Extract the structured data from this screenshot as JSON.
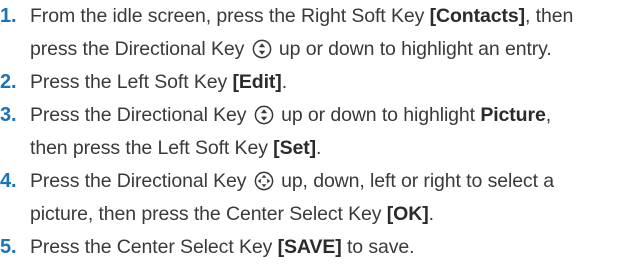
{
  "steps": [
    {
      "number": "1.",
      "line1": {
        "t1": "From the idle screen, press the Right Soft Key ",
        "b1": "[Contacts]",
        "t2": ", then"
      },
      "line2": {
        "t1": "press the Directional Key ",
        "icon": "up-down-navigation-key-icon",
        "t2": " up or down to highlight an entry."
      }
    },
    {
      "number": "2.",
      "line1": {
        "t1": "Press the Left Soft Key ",
        "b1": "[Edit]",
        "t2": "."
      }
    },
    {
      "number": "3.",
      "line1": {
        "t1": "Press the Directional Key ",
        "icon": "up-down-navigation-key-icon",
        "t2": " up or down to highlight ",
        "b1": "Picture",
        "t3": ","
      },
      "line2": {
        "t1": "then press the Left Soft Key ",
        "b1": "[Set]",
        "t2": "."
      }
    },
    {
      "number": "4.",
      "line1": {
        "t1": "Press the Directional Key ",
        "icon": "four-way-navigation-key-icon",
        "t2": " up, down, left or right to select a"
      },
      "line2": {
        "t1": "picture, then press the Center Select Key ",
        "b1": "[OK]",
        "t2": "."
      }
    },
    {
      "number": "5.",
      "line1": {
        "t1": "Press the Center Select Key ",
        "b1": "[SAVE]",
        "t2": " to save."
      }
    }
  ],
  "colors": {
    "step_number": "#1a73b8",
    "body_text": "#3a3a3a"
  }
}
